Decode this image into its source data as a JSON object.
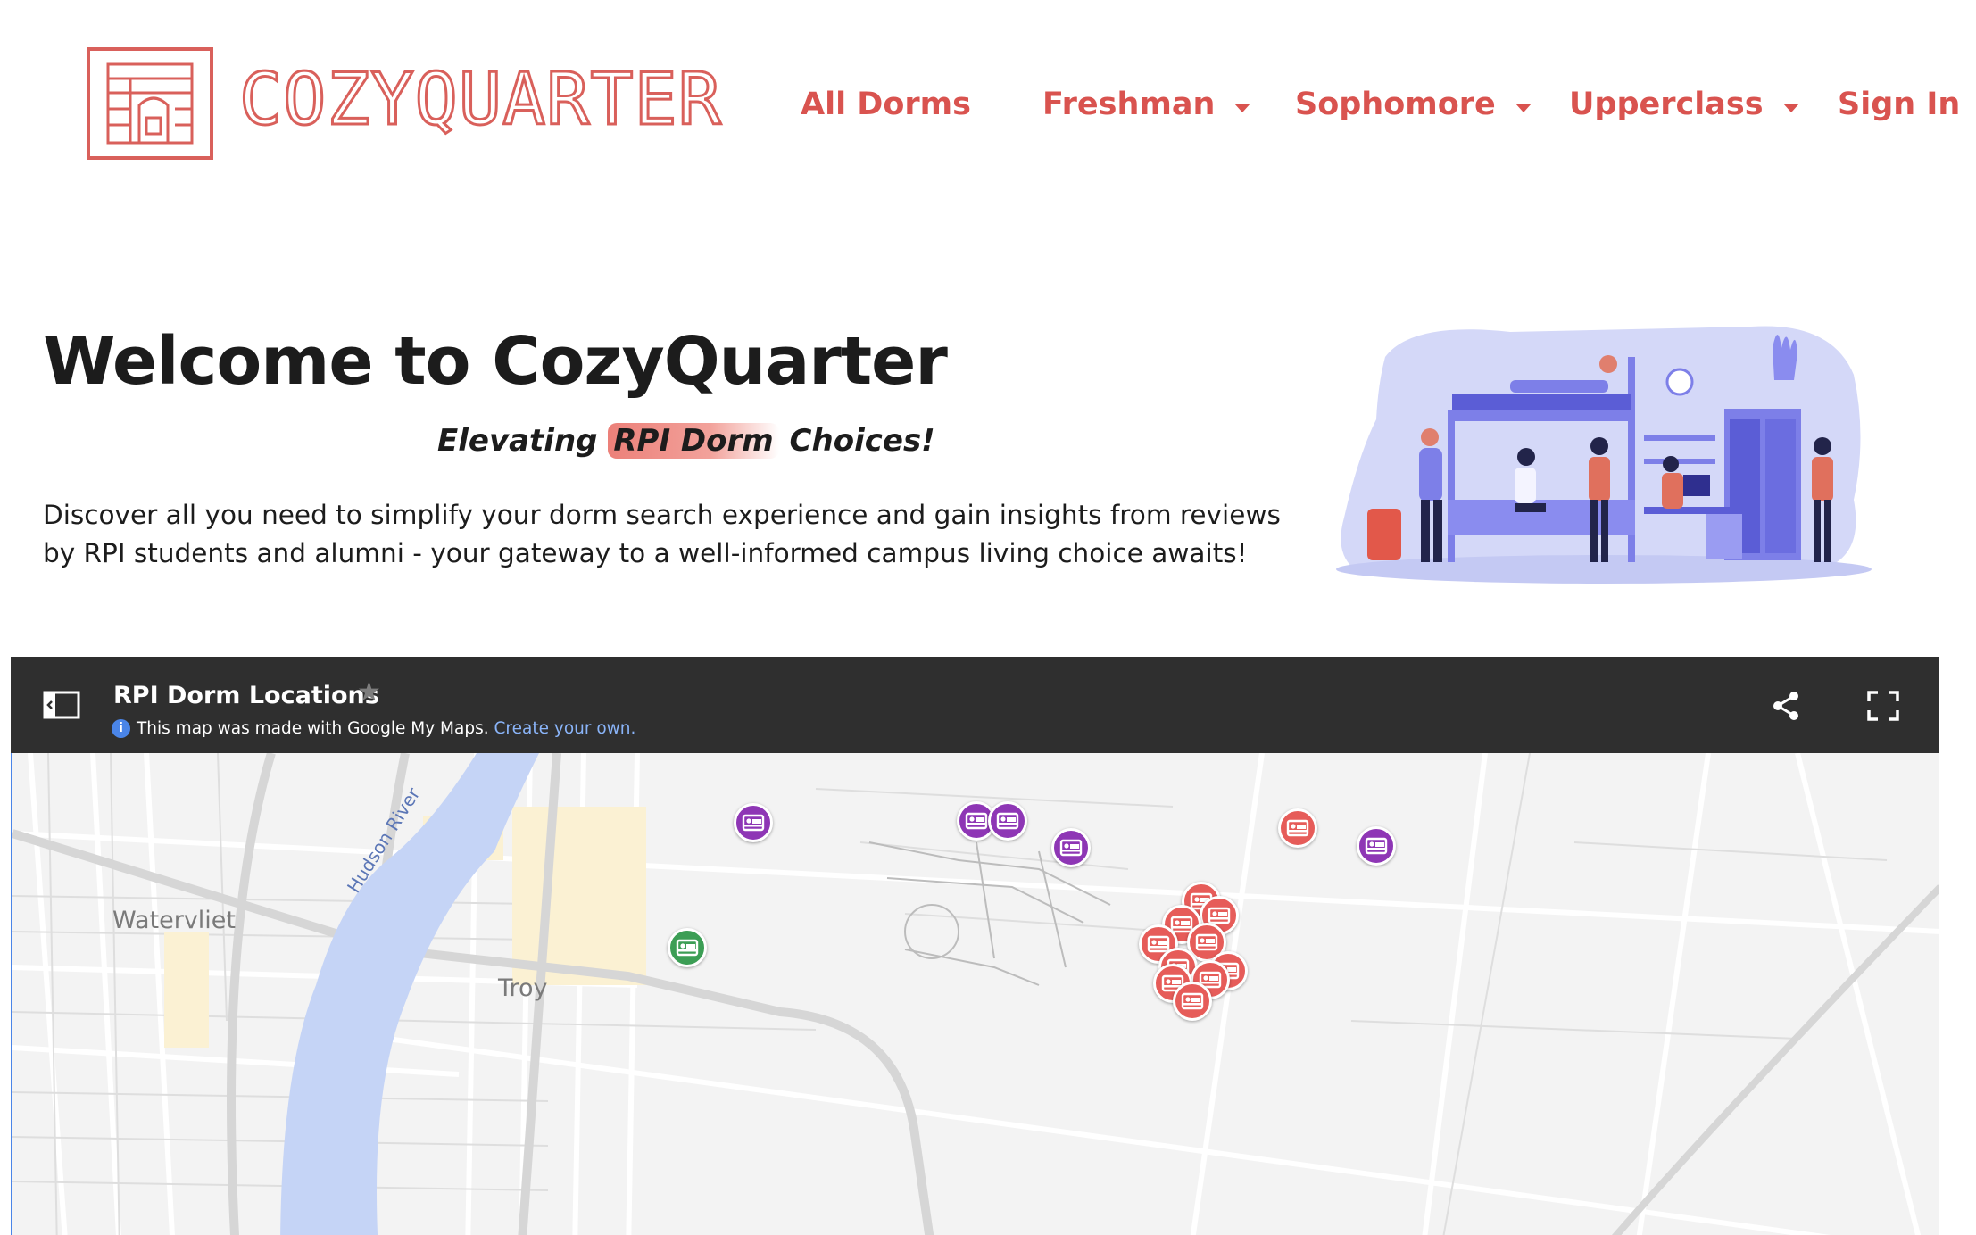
{
  "brand": {
    "name": "COZYQUARTER",
    "color": "#d9534f"
  },
  "nav": {
    "all_dorms": "All Dorms",
    "freshman": "Freshman",
    "sophomore": "Sophomore",
    "upperclass": "Upperclass",
    "sign_in": "Sign In"
  },
  "hero": {
    "title": "Welcome to CozyQuarter",
    "tagline_pre": "Elevating ",
    "tagline_highlight": "RPI Dorm",
    "tagline_post": " Choices!",
    "intro": "Discover all you need to simplify your dorm search experience and gain insights from reviews by RPI students and alumni - your gateway to a well-informed campus living choice awaits!"
  },
  "map": {
    "title": "RPI Dorm Locations",
    "info_text": "This map was made with Google My Maps.",
    "info_link": "Create your own.",
    "labels": {
      "watervliet": "Watervliet",
      "troy": "Troy",
      "river": "Hudson River"
    },
    "pin_colors": {
      "purple": "#8e36b5",
      "red": "#e65c59",
      "green": "#3c9e55"
    },
    "pins": [
      {
        "color": "purple",
        "icon": "bed-icon"
      },
      {
        "color": "purple",
        "icon": "bed-icon"
      },
      {
        "color": "purple",
        "icon": "bed-icon"
      },
      {
        "color": "purple",
        "icon": "bed-icon"
      },
      {
        "color": "purple",
        "icon": "bed-icon"
      },
      {
        "color": "red",
        "icon": "bed-icon"
      },
      {
        "color": "green",
        "icon": "bed-icon"
      },
      {
        "color": "red",
        "icon": "bed-icon"
      },
      {
        "color": "red",
        "icon": "bed-icon"
      },
      {
        "color": "red",
        "icon": "bed-icon"
      },
      {
        "color": "red",
        "icon": "bed-icon"
      },
      {
        "color": "red",
        "icon": "bed-icon"
      },
      {
        "color": "red",
        "icon": "bed-icon"
      },
      {
        "color": "red",
        "icon": "bed-icon"
      },
      {
        "color": "red",
        "icon": "bed-icon"
      },
      {
        "color": "red",
        "icon": "bed-icon"
      },
      {
        "color": "red",
        "icon": "bed-icon"
      }
    ]
  }
}
